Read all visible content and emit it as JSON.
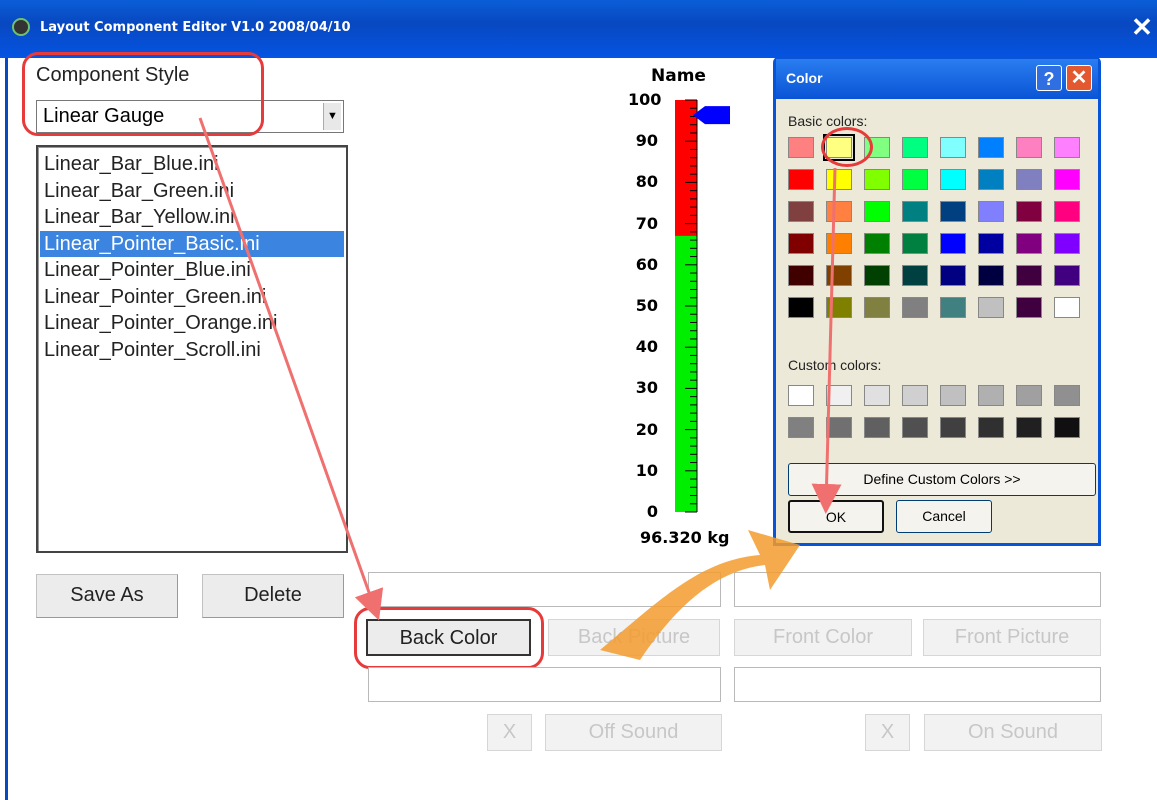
{
  "window": {
    "title": "Layout Component Editor V1.0  2008/04/10",
    "close_glyph": "✕"
  },
  "component_style": {
    "label": "Component Style",
    "selected": "Linear Gauge",
    "dropdown_glyph": "▼",
    "files": [
      "Linear_Bar_Blue.ini",
      "Linear_Bar_Green.ini",
      "Linear_Bar_Yellow.ini",
      "Linear_Pointer_Basic.ini",
      "Linear_Pointer_Blue.ini",
      "Linear_Pointer_Green.ini",
      "Linear_Pointer_Orange.ini",
      "Linear_Pointer_Scroll.ini"
    ],
    "selected_index": 3
  },
  "buttons": {
    "save_as": "Save As",
    "delete": "Delete",
    "back_color": "Back Color",
    "back_picture": "Back Picture",
    "front_color": "Front Color",
    "front_picture": "Front Picture",
    "x1": "X",
    "off_sound": "Off Sound",
    "x2": "X",
    "on_sound": "On Sound"
  },
  "gauge": {
    "name": "Name",
    "ticks": [
      "100",
      "90",
      "80",
      "70",
      "60",
      "50",
      "40",
      "30",
      "20",
      "10",
      "0"
    ],
    "value_text": "96.320 kg",
    "pointer_value": 96.32,
    "red_from": 67,
    "colors": {
      "high": "#ff0000",
      "low": "#00ee00",
      "pointer": "#0000ff"
    }
  },
  "color_dialog": {
    "title": "Color",
    "help": "?",
    "close": "✕",
    "basic_label": "Basic colors:",
    "custom_label": "Custom colors:",
    "define_button": "Define Custom Colors >>",
    "ok": "OK",
    "cancel": "Cancel",
    "selected_swatch": 1,
    "basic_colors": [
      "#ff8080",
      "#ffff80",
      "#80ff80",
      "#00ff80",
      "#80ffff",
      "#0080ff",
      "#ff80c0",
      "#ff80ff",
      "#ff0000",
      "#ffff00",
      "#80ff00",
      "#00ff40",
      "#00ffff",
      "#0080c0",
      "#8080c0",
      "#ff00ff",
      "#804040",
      "#ff8040",
      "#00ff00",
      "#008080",
      "#004080",
      "#8080ff",
      "#800040",
      "#ff0080",
      "#800000",
      "#ff8000",
      "#008000",
      "#008040",
      "#0000ff",
      "#0000a0",
      "#800080",
      "#8000ff",
      "#400000",
      "#804000",
      "#004000",
      "#004040",
      "#000080",
      "#000040",
      "#400040",
      "#400080",
      "#000000",
      "#808000",
      "#808040",
      "#808080",
      "#408080",
      "#c0c0c0",
      "#400040",
      "#ffffff"
    ],
    "custom_colors": [
      "#ffffff",
      "#f0f0f0",
      "#e0e0e0",
      "#d0d0d0",
      "#c0c0c0",
      "#b0b0b0",
      "#a0a0a0",
      "#909090",
      "#808080",
      "#707070",
      "#606060",
      "#505050",
      "#404040",
      "#303030",
      "#202020",
      "#101010"
    ]
  }
}
